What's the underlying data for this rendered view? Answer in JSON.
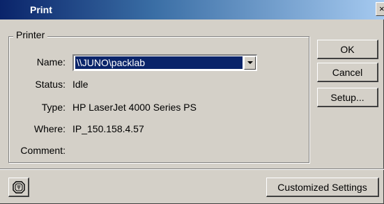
{
  "window": {
    "title": "Print",
    "close_glyph": "×"
  },
  "printer_group": {
    "label": "Printer",
    "name_label": "Name:",
    "name_value": "\\\\JUNO\\packlab",
    "status_label": "Status:",
    "status_value": "Idle",
    "type_label": "Type:",
    "type_value": "HP LaserJet 4000 Series PS",
    "where_label": "Where:",
    "where_value": "IP_150.158.4.57",
    "comment_label": "Comment:",
    "comment_value": ""
  },
  "buttons": {
    "ok": "OK",
    "cancel": "Cancel",
    "setup": "Setup...",
    "customized": "Customized Settings"
  },
  "icons": {
    "help_icon": "stop-sign-icon",
    "dropdown_icon": "chevron-down-icon",
    "close_icon": "close-icon"
  },
  "colors": {
    "titlebar_start": "#0a246a",
    "titlebar_end": "#a6caf0",
    "dialog_bg": "#d4d0c8",
    "selection": "#0a246a"
  }
}
